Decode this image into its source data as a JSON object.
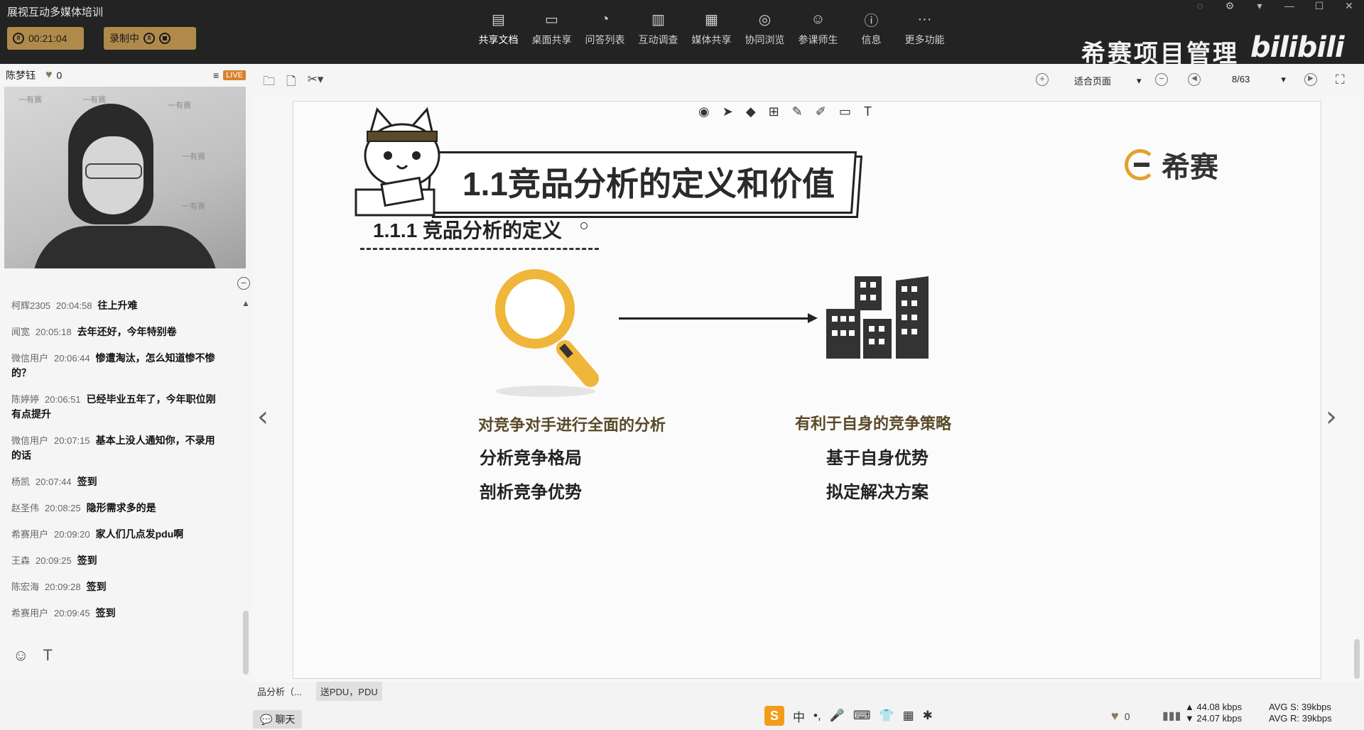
{
  "app": {
    "title": "展视互动多媒体培训"
  },
  "session": {
    "timer": "00:21:04",
    "record_label": "录制中"
  },
  "toolbar": {
    "items": [
      {
        "label": "共享文档",
        "icon": "doc-share-icon",
        "active": true
      },
      {
        "label": "桌面共享",
        "icon": "desktop-share-icon"
      },
      {
        "label": "问答列表",
        "icon": "qa-icon"
      },
      {
        "label": "互动调查",
        "icon": "survey-chart-icon"
      },
      {
        "label": "媒体共享",
        "icon": "media-film-icon"
      },
      {
        "label": "协同浏览",
        "icon": "compass-icon"
      },
      {
        "label": "参课师生",
        "icon": "users-icon"
      },
      {
        "label": "信息",
        "icon": "info-icon"
      },
      {
        "label": "更多功能",
        "icon": "more-icon"
      }
    ]
  },
  "brand": {
    "text": "希赛项目管理",
    "logo": "bilibili"
  },
  "presenter": {
    "name": "陈梦钰",
    "likes": "0",
    "live": "LIVE"
  },
  "chat": {
    "messages": [
      {
        "user": "柯辉2305",
        "time": "20:04:58",
        "text": "往上升难"
      },
      {
        "user": "闻宽",
        "time": "20:05:18",
        "text": "去年还好，今年特别卷"
      },
      {
        "user": "微信用户",
        "time": "20:06:44",
        "text": "惨遭淘汰，怎么知道惨不惨的？"
      },
      {
        "user": "陈婷婷",
        "time": "20:06:51",
        "text": "已经毕业五年了，今年职位刚有点提升"
      },
      {
        "user": "微信用户",
        "time": "20:07:15",
        "text": "基本上没人通知你，不录用的话"
      },
      {
        "user": "杨凯",
        "time": "20:07:44",
        "text": "签到"
      },
      {
        "user": "赵圣伟",
        "time": "20:08:25",
        "text": "隐形需求多的是"
      },
      {
        "user": "希赛用户",
        "time": "20:09:20",
        "text": "家人们几点发pdu啊"
      },
      {
        "user": "王森",
        "time": "20:09:25",
        "text": "签到"
      },
      {
        "user": "陈宏海",
        "time": "20:09:28",
        "text": "签到"
      },
      {
        "user": "希赛用户",
        "time": "20:09:45",
        "text": "签到"
      }
    ]
  },
  "viewer": {
    "fit_mode": "适合页面",
    "page": "8/63"
  },
  "slide": {
    "title": "1.1竞品分析的定义和价值",
    "logo_text": "希赛",
    "subtitle": "1.1.1 竞品分析的定义",
    "left_heading": "对竞争对手进行全面的分析",
    "left_lines": [
      "分析竞争格局",
      "剖析竞争优势"
    ],
    "right_heading": "有利于自身的竞争策略",
    "right_lines": [
      "基于自身优势",
      "拟定解决方案"
    ]
  },
  "bottom": {
    "doc_tabs": [
      "品分析（...",
      "送PDU，PDU"
    ],
    "chat_tab": "聊天",
    "ime_label": "中",
    "likes": "0",
    "net_up": "44.08 kbps",
    "net_down": "24.07 kbps",
    "avg_s": "AVG S: 39kbps",
    "avg_r": "AVG R: 39kbps"
  },
  "colors": {
    "accent": "#b08a4a",
    "magnifier": "#f0b63a",
    "dark": "#232323"
  }
}
